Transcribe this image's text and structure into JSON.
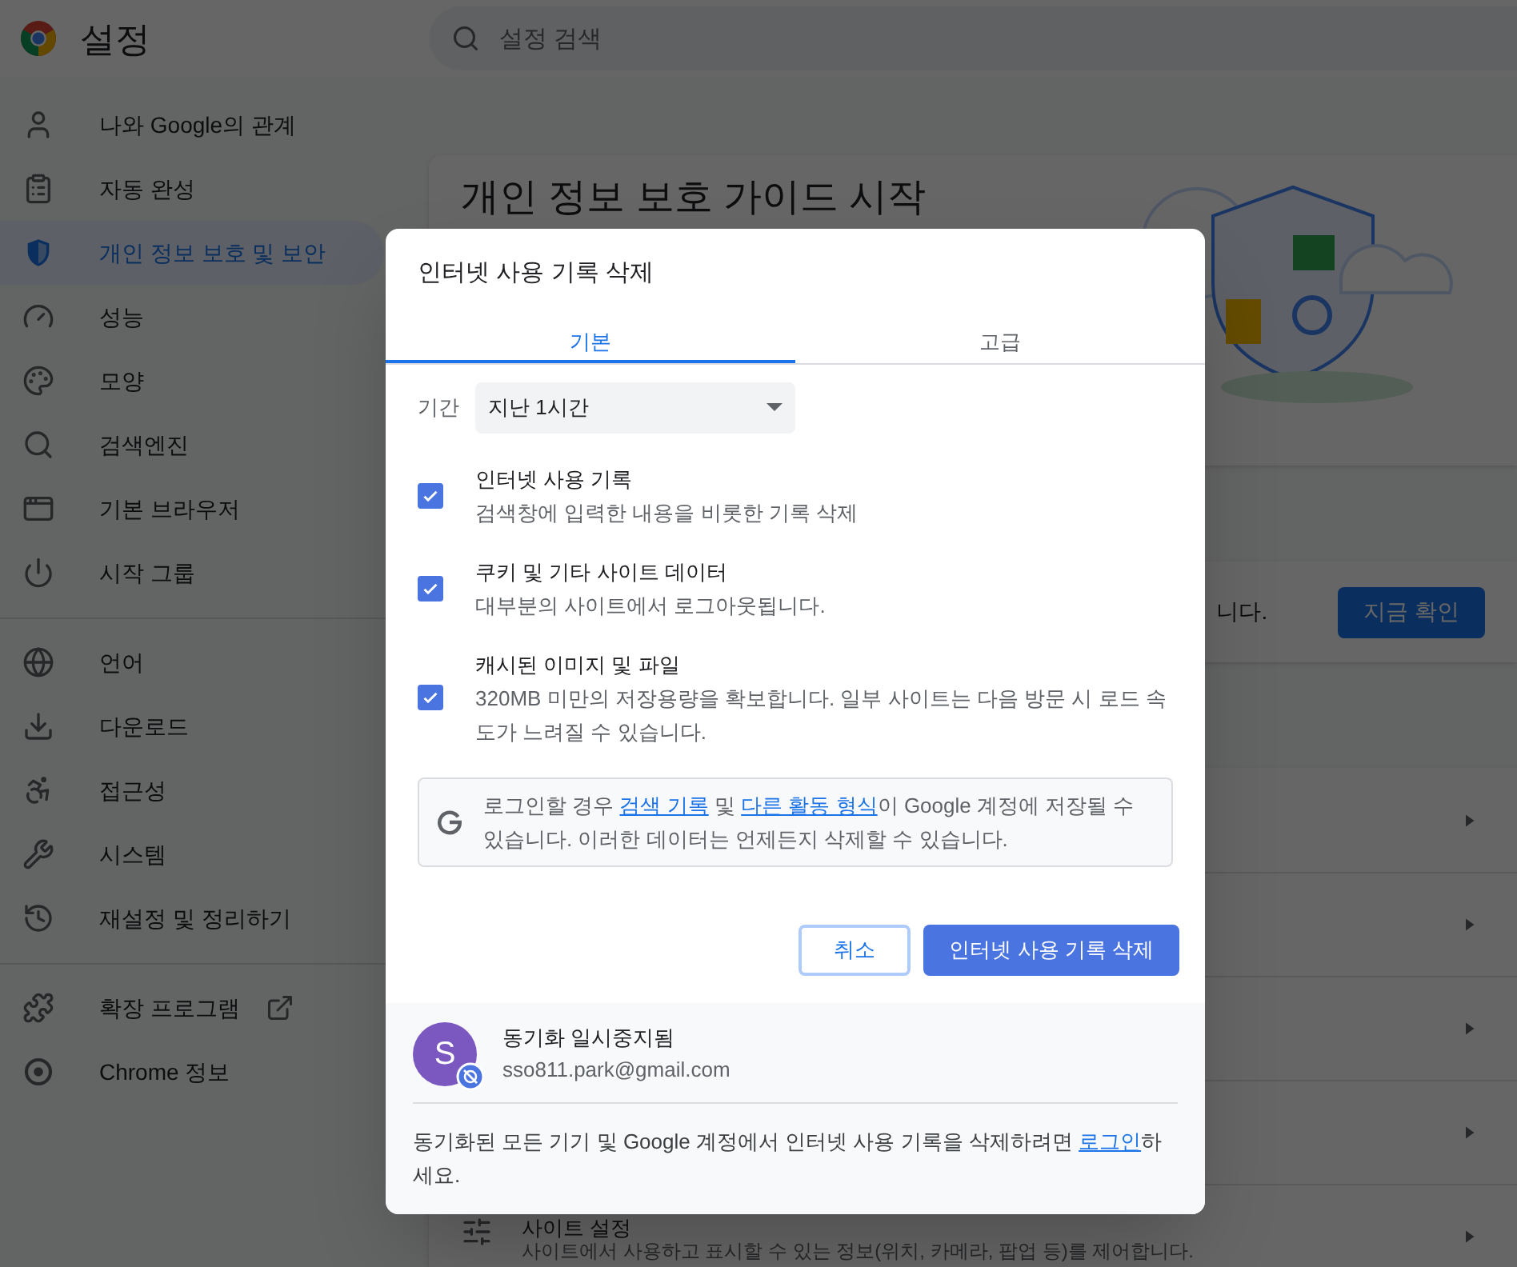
{
  "header": {
    "title": "설정",
    "search": {
      "placeholder": "설정 검색"
    }
  },
  "sidebar": {
    "groups": [
      [
        {
          "label": "나와 Google의 관계",
          "kind": "person",
          "selected": false
        },
        {
          "label": "자동 완성",
          "kind": "clipboard",
          "selected": false
        },
        {
          "label": "개인 정보 보호 및 보안",
          "kind": "shield",
          "selected": true
        },
        {
          "label": "성능",
          "kind": "gauge",
          "selected": false
        },
        {
          "label": "모양",
          "kind": "palette",
          "selected": false
        },
        {
          "label": "검색엔진",
          "kind": "search",
          "selected": false
        },
        {
          "label": "기본 브라우저",
          "kind": "browser",
          "selected": false
        },
        {
          "label": "시작 그룹",
          "kind": "power",
          "selected": false
        }
      ],
      [
        {
          "label": "언어",
          "kind": "globe",
          "selected": false
        },
        {
          "label": "다운로드",
          "kind": "download",
          "selected": false
        },
        {
          "label": "접근성",
          "kind": "accessibility",
          "selected": false
        },
        {
          "label": "시스템",
          "kind": "wrench",
          "selected": false
        },
        {
          "label": "재설정 및 정리하기",
          "kind": "history",
          "selected": false
        }
      ],
      [
        {
          "label": "확장 프로그램",
          "kind": "puzzle",
          "selected": false,
          "external_link": true
        },
        {
          "label": "Chrome 정보",
          "kind": "chrome",
          "selected": false
        }
      ]
    ]
  },
  "main": {
    "guide_card": {
      "title": "개인 정보 보호 가이드 시작"
    },
    "safety_card": {
      "text": "니다.",
      "button": "지금 확인"
    },
    "rows": [
      {
        "kind": "blank"
      },
      {
        "kind": "blank"
      },
      {
        "kind": "blank"
      },
      {
        "kind": "blank"
      },
      {
        "kind": "site-settings",
        "title": "사이트 설정",
        "description": "사이트에서 사용하고 표시할 수 있는 정보(위치, 카메라, 팝업 등)를 제어합니다."
      }
    ]
  },
  "dialog": {
    "title": "인터넷 사용 기록 삭제",
    "tabs": [
      {
        "label": "기본",
        "selected": true
      },
      {
        "label": "고급",
        "selected": false
      }
    ],
    "period": {
      "label": "기간",
      "value": "지난 1시간"
    },
    "options": [
      {
        "title": "인터넷 사용 기록",
        "description": "검색창에 입력한 내용을 비롯한 기록 삭제",
        "checked": true
      },
      {
        "title": "쿠키 및 기타 사이트 데이터",
        "description": "대부분의 사이트에서 로그아웃됩니다.",
        "checked": true
      },
      {
        "title": "캐시된 이미지 및 파일",
        "description": "320MB 미만의 저장용량을 확보합니다. 일부 사이트는 다음 방문 시 로드 속도가 느려질 수 있습니다.",
        "checked": true
      }
    ],
    "info": {
      "parts": [
        {
          "text": "로그인할 경우 "
        },
        {
          "text": "검색 기록",
          "link": true
        },
        {
          "text": " 및 "
        },
        {
          "text": "다른 활동 형식",
          "link": true
        },
        {
          "text": "이 Google 계정에 저장될 수 있습니다. 이러한 데이터는 언제든지 삭제할 수 있습니다."
        }
      ]
    },
    "buttons": {
      "cancel": "취소",
      "confirm": "인터넷 사용 기록 삭제"
    },
    "account": {
      "initial": "S",
      "status": "동기화 일시중지됨",
      "email": "sso811.park@gmail.com"
    },
    "note": {
      "parts": [
        {
          "text": "동기화된 모든 기기 및 Google 계정에서 인터넷 사용 기록을 삭제하려면 "
        },
        {
          "text": "로그인",
          "link": true
        },
        {
          "text": "하세요."
        }
      ]
    }
  }
}
